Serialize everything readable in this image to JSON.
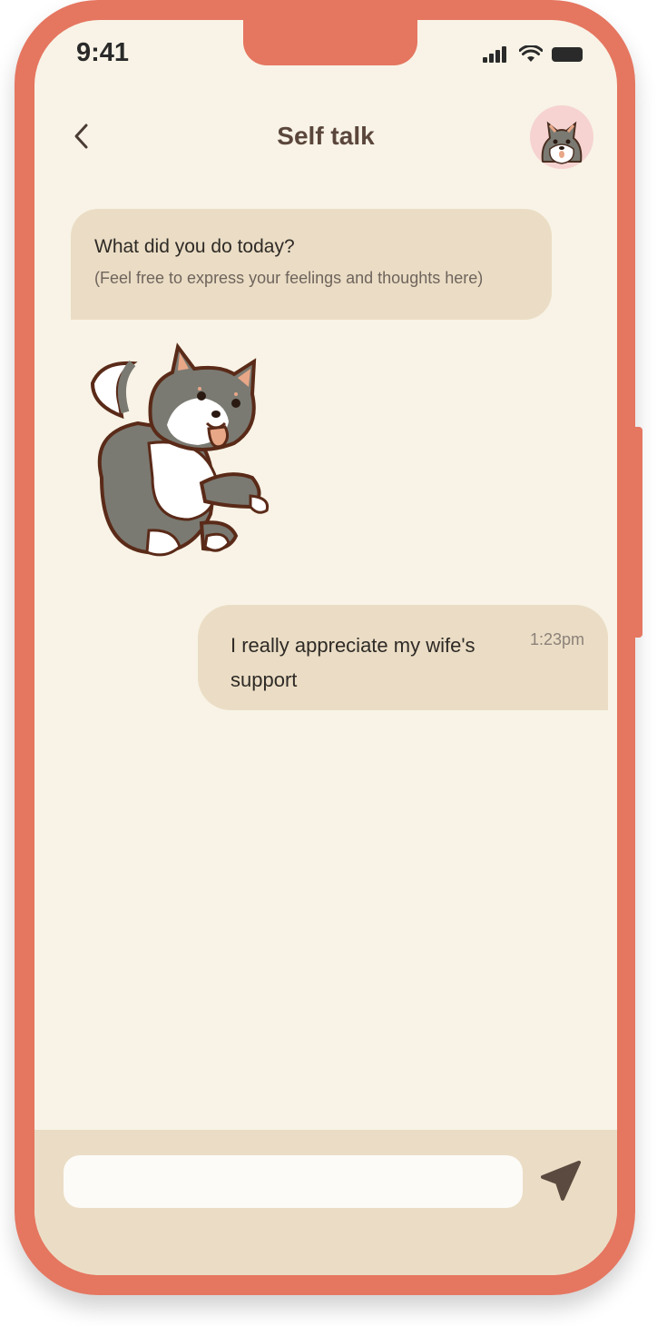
{
  "status_bar": {
    "time": "9:41"
  },
  "header": {
    "title": "Self talk"
  },
  "messages": [
    {
      "sender": "bot",
      "text": "What did you do today?",
      "hint": "(Feel free to express your feelings and thoughts here)"
    },
    {
      "sender": "bot",
      "type": "sticker",
      "icon": "shiba-dog-sticker"
    },
    {
      "sender": "user",
      "text": "I really appreciate my wife's support",
      "time": "1:23pm"
    }
  ],
  "composer": {
    "value": "",
    "placeholder": ""
  },
  "colors": {
    "frame": "#E57660",
    "screen_bg": "#F8F3E6",
    "bubble": "#EBDDC5",
    "title": "#5B463C",
    "avatar_bg": "#F6D3D0",
    "send_icon": "#5B4A3F"
  }
}
